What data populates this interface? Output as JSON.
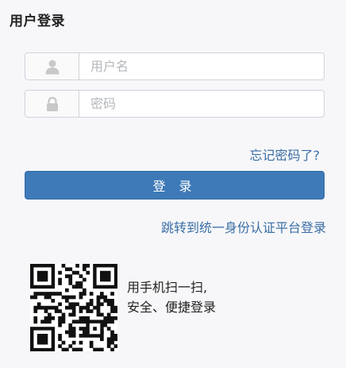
{
  "header": {
    "title": "用户登录"
  },
  "form": {
    "username": {
      "placeholder": "用户名",
      "value": "",
      "icon": "user-icon"
    },
    "password": {
      "placeholder": "密码",
      "value": "",
      "icon": "lock-icon"
    },
    "forgot_label": "忘记密码了?",
    "login_label": "登 录",
    "sso_label": "跳转到统一身份认证平台登录"
  },
  "qr": {
    "line1": "用手机扫一扫,",
    "line2": "安全、便捷登录"
  },
  "colors": {
    "accent": "#3e7ab8",
    "link": "#3a6ea5",
    "background": "#f7f7f9"
  }
}
